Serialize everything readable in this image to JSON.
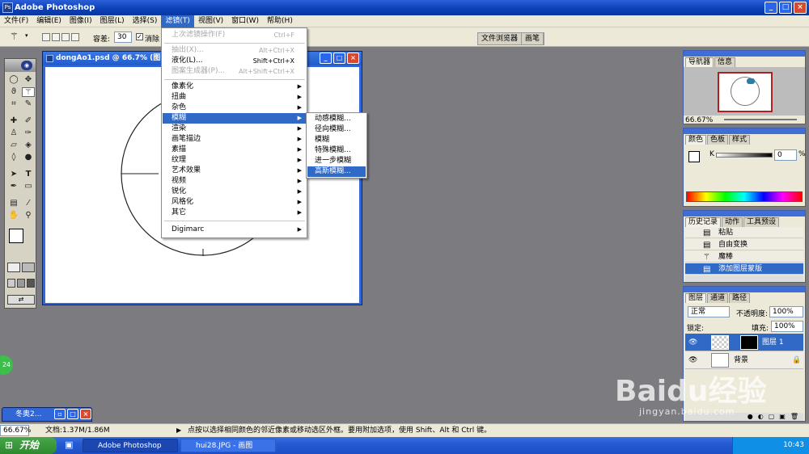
{
  "app": {
    "title": "Adobe Photoshop"
  },
  "menubar": {
    "items": [
      "文件(F)",
      "编辑(E)",
      "图像(I)",
      "图层(L)",
      "选择(S)",
      "滤镜(T)",
      "视图(V)",
      "窗口(W)",
      "帮助(H)"
    ],
    "active_index": 5
  },
  "options": {
    "tolerance_label": "容差:",
    "tolerance_value": "30",
    "antialias_label": "消除"
  },
  "panel_tabs": [
    "文件浏览器",
    "画笔"
  ],
  "document": {
    "title": "dongAo1.psd @ 66.7% (图"
  },
  "filter_menu": {
    "items": [
      {
        "label": "上次滤镜操作(F)",
        "shortcut": "Ctrl+F",
        "disabled": true
      },
      {
        "label": "抽出(X)...",
        "shortcut": "Alt+Ctrl+X",
        "disabled": true
      },
      {
        "label": "液化(L)...",
        "shortcut": "Shift+Ctrl+X",
        "disabled": false
      },
      {
        "label": "图案生成器(P)...",
        "shortcut": "Alt+Shift+Ctrl+X",
        "disabled": true
      },
      {
        "label": "像素化",
        "submenu": true
      },
      {
        "label": "扭曲",
        "submenu": true
      },
      {
        "label": "杂色",
        "submenu": true
      },
      {
        "label": "模糊",
        "submenu": true,
        "highlighted": true
      },
      {
        "label": "渲染",
        "submenu": true
      },
      {
        "label": "画笔描边",
        "submenu": true
      },
      {
        "label": "素描",
        "submenu": true
      },
      {
        "label": "纹理",
        "submenu": true
      },
      {
        "label": "艺术效果",
        "submenu": true
      },
      {
        "label": "视频",
        "submenu": true
      },
      {
        "label": "锐化",
        "submenu": true
      },
      {
        "label": "风格化",
        "submenu": true
      },
      {
        "label": "其它",
        "submenu": true
      },
      {
        "label": "Digimarc",
        "submenu": true
      }
    ]
  },
  "blur_submenu": {
    "items": [
      "动感模糊...",
      "径向模糊...",
      "模糊",
      "特殊模糊...",
      "进一步模糊",
      "高斯模糊..."
    ],
    "highlighted_index": 5
  },
  "navigator": {
    "tabs": [
      "导航器",
      "信息"
    ],
    "zoom": "66.67%"
  },
  "color": {
    "tabs": [
      "颜色",
      "色板",
      "样式"
    ],
    "channel": "K",
    "value": "0",
    "unit": "%"
  },
  "history": {
    "tabs": [
      "历史记录",
      "动作",
      "工具预设"
    ],
    "items": [
      "粘贴",
      "自由变换",
      "魔棒",
      "添加图层蒙版"
    ],
    "selected_index": 3
  },
  "layers": {
    "tabs": [
      "图层",
      "通道",
      "路径"
    ],
    "blend_mode": "正常",
    "opacity_label": "不透明度:",
    "opacity_value": "100%",
    "lock_label": "锁定:",
    "fill_label": "填充:",
    "fill_value": "100%",
    "rows": [
      {
        "name": "图层 1",
        "selected": true
      },
      {
        "name": "背景",
        "selected": false
      }
    ]
  },
  "status": {
    "zoom": "66.67%",
    "doc": "文档:1.37M/1.86M",
    "hint": "点按以选择相同颜色的邻近像素或移动选区外框。要用附加选项，使用 Shift、Alt 和 Ctrl 键。"
  },
  "minimized_window": {
    "title": "冬奥2..."
  },
  "taskbar": {
    "start": "开始",
    "tasks": [
      "Adobe Photoshop",
      "hui28.JPG - 画图"
    ],
    "clock": "10:43"
  },
  "watermark": {
    "brand": "Baidu经验",
    "url": "jingyan.baidu.com"
  },
  "badge": {
    "text": "24"
  }
}
